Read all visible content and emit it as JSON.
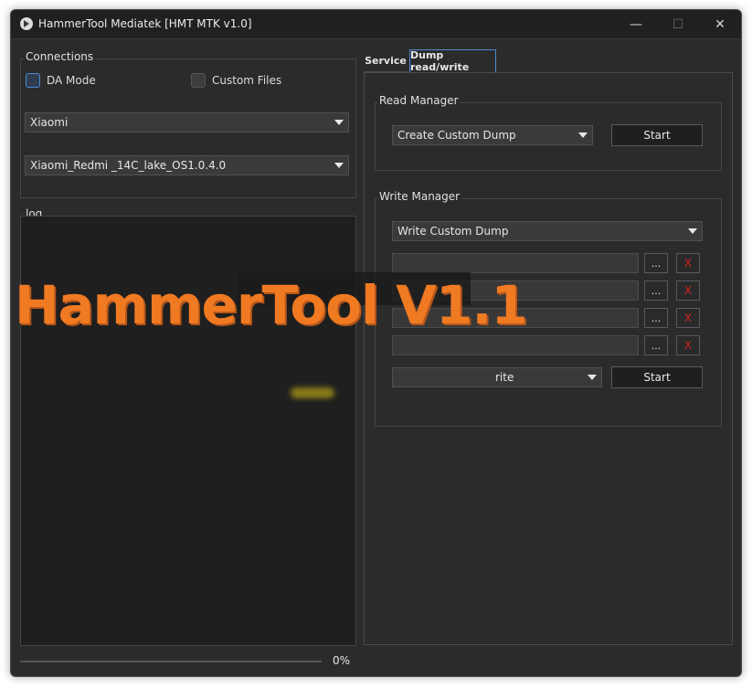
{
  "window": {
    "title": "HammerTool Mediatek [HMT MTK v1.0]",
    "controls": {
      "minimize": "—",
      "maximize": "☐",
      "close": "✕"
    }
  },
  "connections": {
    "label": "Connections",
    "da_mode": {
      "label": "DA Mode",
      "checked": false
    },
    "custom_files": {
      "label": "Custom Files",
      "checked": false
    },
    "brand_select": {
      "value": "Xiaomi"
    },
    "model_select": {
      "value": "Xiaomi_Redmi _14C_lake_OS1.0.4.0"
    }
  },
  "log": {
    "label": "log"
  },
  "tabs": [
    {
      "label": "Service",
      "active": false
    },
    {
      "label": "Dump read/write",
      "active": true
    }
  ],
  "read_manager": {
    "label": "Read Manager",
    "select": {
      "value": "Create Custom Dump"
    },
    "start_label": "Start"
  },
  "write_manager": {
    "label": "Write Manager",
    "select": {
      "value": "Write Custom Dump"
    },
    "rows": [
      {
        "browse_label": "...",
        "clear_label": "X"
      },
      {
        "browse_label": "...",
        "clear_label": "X"
      },
      {
        "browse_label": "...",
        "clear_label": "X"
      },
      {
        "browse_label": "...",
        "clear_label": "X"
      }
    ],
    "mode_select": {
      "value": "rite"
    },
    "start_label": "Start"
  },
  "progress": {
    "value": 0,
    "text": "0%"
  },
  "watermark": "HammerTool V1.1",
  "colors": {
    "accent": "#4a8cd6",
    "watermark": "#f07a22",
    "clear": "#d42020"
  }
}
